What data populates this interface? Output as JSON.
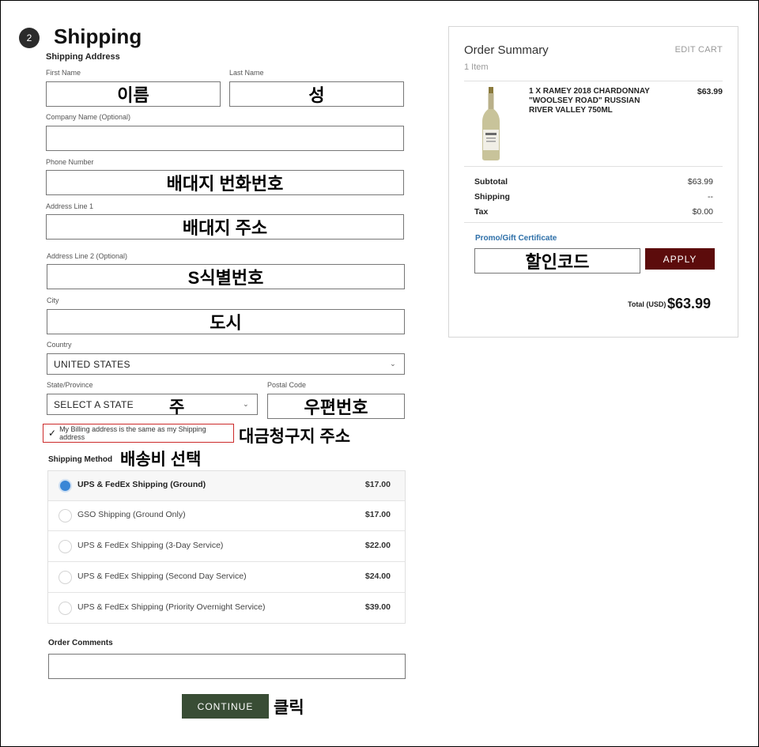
{
  "step": {
    "number": "2",
    "title": "Shipping"
  },
  "shipping_address": {
    "heading": "Shipping Address",
    "first_name": {
      "label": "First Name",
      "note": "이름"
    },
    "last_name": {
      "label": "Last Name",
      "note": "성"
    },
    "company": {
      "label": "Company Name (Optional)",
      "note": ""
    },
    "phone": {
      "label": "Phone Number",
      "note": "배대지 번화번호"
    },
    "address1": {
      "label": "Address Line 1",
      "note": "배대지 주소"
    },
    "address2": {
      "label": "Address Line 2 (Optional)",
      "note": "S식별번호"
    },
    "city": {
      "label": "City",
      "note": "도시"
    },
    "country": {
      "label": "Country",
      "value": "UNITED STATES"
    },
    "state": {
      "label": "State/Province",
      "value": "SELECT A STATE",
      "note": "주"
    },
    "postal": {
      "label": "Postal Code",
      "note": "우편번호"
    }
  },
  "billing_same": {
    "label": "My Billing address is the same as my Shipping address",
    "checked": true,
    "note": "대금청구지 주소"
  },
  "shipping_method": {
    "heading": "Shipping Method",
    "note": "배송비 선택",
    "options": [
      {
        "name": "UPS & FedEx Shipping (Ground)",
        "price": "$17.00",
        "selected": true
      },
      {
        "name": "GSO Shipping (Ground Only)",
        "price": "$17.00",
        "selected": false
      },
      {
        "name": "UPS & FedEx Shipping (3-Day Service)",
        "price": "$22.00",
        "selected": false
      },
      {
        "name": "UPS & FedEx Shipping (Second Day Service)",
        "price": "$24.00",
        "selected": false
      },
      {
        "name": "UPS & FedEx Shipping (Priority Overnight Service)",
        "price": "$39.00",
        "selected": false
      }
    ]
  },
  "order_comments": {
    "label": "Order Comments"
  },
  "continue": {
    "label": "CONTINUE",
    "note": "클릭",
    "color": "#394d35"
  },
  "summary": {
    "title": "Order Summary",
    "edit_cart": "EDIT CART",
    "item_count": "1 Item",
    "product": {
      "name": "1 X RAMEY 2018 CHARDONNAY \"WOOLSEY ROAD\" RUSSIAN RIVER VALLEY 750ML",
      "price": "$63.99",
      "image_icon": "wine-bottle-icon"
    },
    "subtotal": {
      "label": "Subtotal",
      "value": "$63.99"
    },
    "shipping": {
      "label": "Shipping",
      "value": "--"
    },
    "tax": {
      "label": "Tax",
      "value": "$0.00"
    },
    "promo": {
      "label": "Promo/Gift Certificate",
      "note": "할인코드",
      "apply": "APPLY",
      "apply_color": "#5c0c0c"
    },
    "total": {
      "label": "Total (USD)",
      "value": "$63.99"
    }
  }
}
